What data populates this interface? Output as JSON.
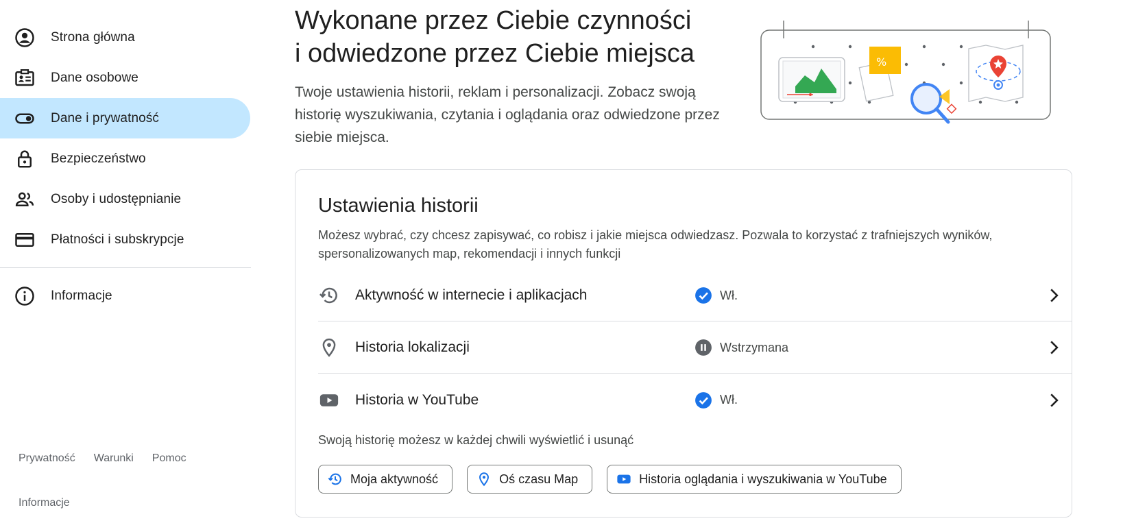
{
  "sidebar": {
    "items": [
      {
        "label": "Strona główna",
        "icon": "account-circle-icon"
      },
      {
        "label": "Dane osobowe",
        "icon": "id-card-icon"
      },
      {
        "label": "Dane i prywatność",
        "icon": "toggle-icon",
        "active": true
      },
      {
        "label": "Bezpieczeństwo",
        "icon": "lock-icon"
      },
      {
        "label": "Osoby i udostępnianie",
        "icon": "people-icon"
      },
      {
        "label": "Płatności i subskrypcje",
        "icon": "credit-card-icon"
      }
    ],
    "info_item": {
      "label": "Informacje",
      "icon": "info-icon"
    },
    "active_color": "#c2e7ff"
  },
  "footer": {
    "links": [
      "Prywatność",
      "Warunki",
      "Pomoc"
    ],
    "info": "Informacje"
  },
  "header": {
    "title_line1": "Wykonane przez Ciebie czynności",
    "title_line2": "i odwiedzone przez Ciebie miejsca",
    "description": "Twoje ustawienia historii, reklam i personalizacji. Zobacz swoją historię wyszukiwania, czytania i oglądania oraz odwiedzone przez siebie miejsca."
  },
  "history_card": {
    "title": "Ustawienia historii",
    "description": "Możesz wybrać, czy chcesz zapisywać, co robisz i jakie miejsca odwiedzasz. Pozwala to korzystać z trafniejszych wyników, spersonalizowanych map, rekomendacji i innych funkcji",
    "rows": [
      {
        "label": "Aktywność w internecie i aplikacjach",
        "status": "Wł.",
        "status_type": "on",
        "icon": "history-icon"
      },
      {
        "label": "Historia lokalizacji",
        "status": "Wstrzymana",
        "status_type": "paused",
        "icon": "location-pin-icon"
      },
      {
        "label": "Historia w YouTube",
        "status": "Wł.",
        "status_type": "on",
        "icon": "youtube-icon"
      }
    ],
    "note": "Swoją historię możesz w każdej chwili wyświetlić i usunąć",
    "chips": [
      {
        "label": "Moja aktywność",
        "icon": "history-icon"
      },
      {
        "label": "Oś czasu Map",
        "icon": "location-pin-icon"
      },
      {
        "label": "Historia oglądania i wyszukiwania w YouTube",
        "icon": "youtube-icon"
      }
    ]
  },
  "colors": {
    "accent_blue": "#1a73e8",
    "status_on": "#1a73e8",
    "status_paused": "#5f6368",
    "youtube_red": "#ff0000"
  }
}
